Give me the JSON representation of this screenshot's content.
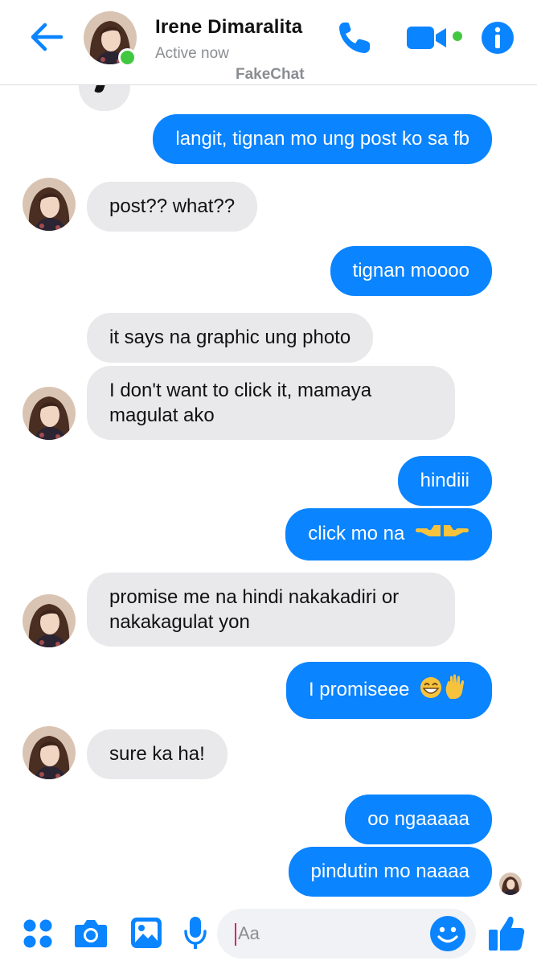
{
  "header": {
    "contact_name": "Irene Dimaralita",
    "status": "Active now",
    "watermark": "FakeChat"
  },
  "colors": {
    "accent": "#0a84ff",
    "outgoing_bubble": "#0a84ff",
    "incoming_bubble": "#e9e9eb",
    "online": "#42c840"
  },
  "icons": [
    "back-arrow-icon",
    "phone-icon",
    "video-camera-icon",
    "info-icon",
    "apps-icon",
    "camera-icon",
    "image-icon",
    "microphone-icon",
    "smiley-icon",
    "thumbs-up-icon"
  ],
  "messages": [
    {
      "from": "me",
      "text": "langit, tignan mo ung post ko sa fb"
    },
    {
      "from": "them",
      "text": "post?? what??"
    },
    {
      "from": "me",
      "text": "tignan moooo"
    },
    {
      "from": "them",
      "text": "it says na graphic ung photo"
    },
    {
      "from": "them",
      "text": "I don't want to click it, mamaya magulat ako"
    },
    {
      "from": "me",
      "text": "hindiii"
    },
    {
      "from": "me",
      "text": "click mo na",
      "emoji": "pointing-hands"
    },
    {
      "from": "them",
      "text": "promise me na hindi nakakadiri or nakakagulat yon"
    },
    {
      "from": "me",
      "text": "I promiseee",
      "emoji": "grin-and-raised-hand"
    },
    {
      "from": "them",
      "text": "sure ka ha!"
    },
    {
      "from": "me",
      "text": "oo ngaaaaa"
    },
    {
      "from": "me",
      "text": "pindutin mo naaaa"
    }
  ],
  "composer": {
    "placeholder": "Aa"
  }
}
